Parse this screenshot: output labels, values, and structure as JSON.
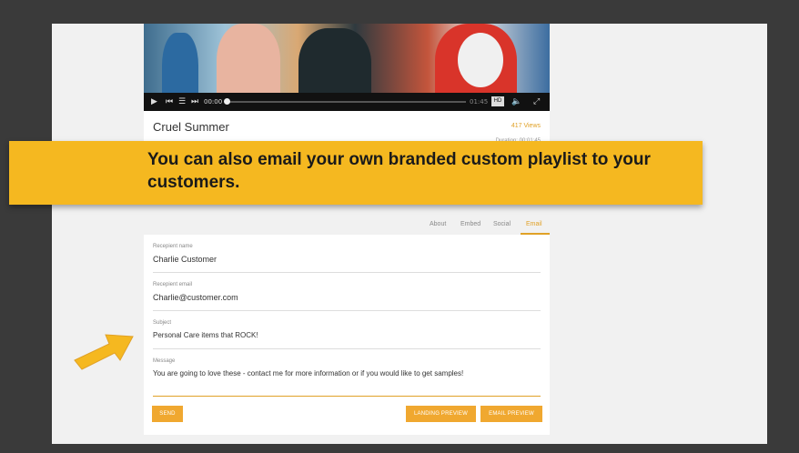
{
  "video": {
    "time_current": "00:00",
    "time_total": "01:45",
    "hd_label": "HD"
  },
  "info": {
    "title": "Cruel Summer",
    "views": "417 Views",
    "duration": "Duration: 00:01:45"
  },
  "banner": {
    "text": "You can also email your own branded custom playlist to your customers."
  },
  "tabs": [
    {
      "label": "About"
    },
    {
      "label": "Embed"
    },
    {
      "label": "Social"
    },
    {
      "label": "Email",
      "active": true
    }
  ],
  "form": {
    "recipient_name_label": "Recepient name",
    "recipient_name": "Charlie Customer",
    "recipient_email_label": "Recepient email",
    "recipient_email": "Charlie@customer.com",
    "subject_label": "Subject",
    "subject": "Personal Care items that ROCK!",
    "message_label": "Message",
    "message": "You are going to love these - contact me for more information or if you would like to get samples!"
  },
  "buttons": {
    "send": "SEND",
    "landing_preview": "LANDING PREVIEW",
    "email_preview": "EMAIL PREVIEW"
  },
  "colors": {
    "accent": "#e0a127",
    "banner": "#f5b820",
    "button": "#f0a830",
    "frame": "#3a3a3a"
  }
}
